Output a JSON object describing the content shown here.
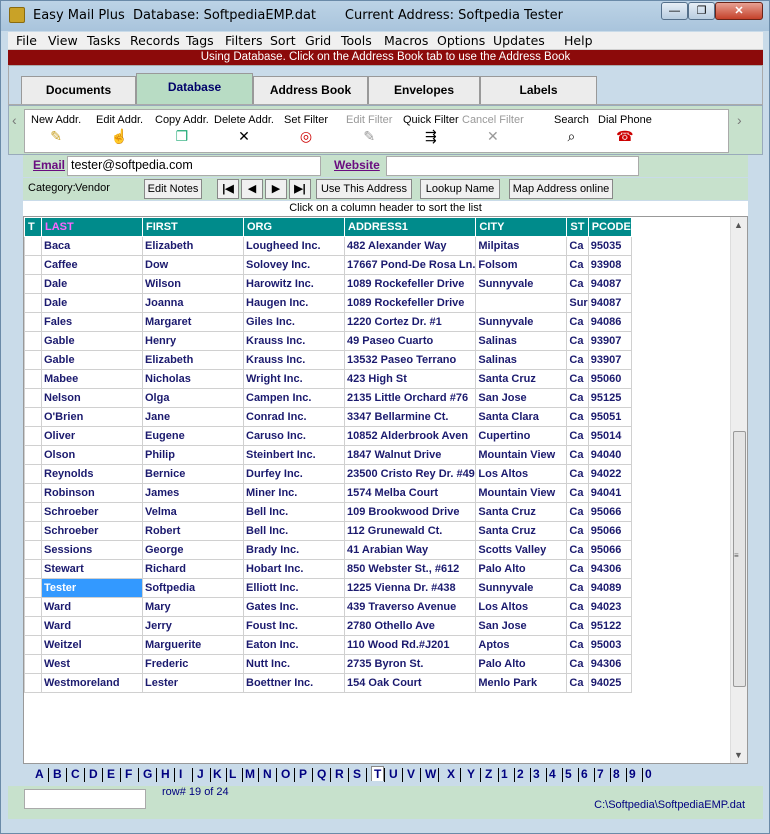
{
  "window": {
    "title": "Easy Mail Plus  Database: SoftpediaEMP.dat       Current Address: Softpedia Tester",
    "min": "—",
    "max": "❐",
    "close": "✕"
  },
  "menu": [
    "File",
    "View",
    "Tasks",
    "Records",
    "Tags",
    "Filters",
    "Sort",
    "Grid",
    "Tools",
    "Macros",
    "Options",
    "Updates",
    "Help"
  ],
  "banner": "Using Database. Click on the Address Book tab to use the Address Book",
  "tabs": [
    "Documents",
    "Database",
    "Address Book",
    "Envelopes",
    "Labels"
  ],
  "active_tab": "Database",
  "toolbar": {
    "new_addr": "New Addr.",
    "edit_addr": "Edit Addr.",
    "copy_addr": "Copy Addr.",
    "delete_addr": "Delete Addr.",
    "set_filter": "Set Filter",
    "edit_filter": "Edit Filter",
    "quick_filter": "Quick Filter",
    "cancel_filter": "Cancel Filter",
    "search": "Search",
    "dial_phone": "Dial Phone"
  },
  "contact": {
    "email_label": "Email",
    "email_value": "tester@softpedia.com",
    "website_label": "Website",
    "website_value": ""
  },
  "category": {
    "label": "Category:",
    "value": "Vendor",
    "edit_notes": "Edit Notes",
    "first": "|◀",
    "prev": "◀",
    "next": "▶",
    "last": "▶|",
    "use_address": "Use This Address",
    "lookup_name": "Lookup Name",
    "map_address": "Map Address online"
  },
  "hint": "Click on a column header to sort the list",
  "grid": {
    "columns": [
      "T",
      "LAST",
      "FIRST",
      "ORG",
      "ADDRESS1",
      "CITY",
      "ST",
      "PCODE"
    ],
    "sorted_column": "LAST",
    "rows": [
      [
        "",
        "Baca",
        "Elizabeth",
        "Lougheed Inc.",
        "482 Alexander Way",
        "Milpitas",
        "Ca",
        "95035"
      ],
      [
        "",
        "Caffee",
        "Dow",
        "Solovey Inc.",
        "17667 Pond-De Rosa Ln.",
        "Folsom",
        "Ca",
        "93908"
      ],
      [
        "",
        "Dale",
        "Wilson",
        "Harowitz Inc.",
        "1089 Rockefeller Drive",
        "Sunnyvale",
        "Ca",
        "94087"
      ],
      [
        "",
        "Dale",
        "Joanna",
        "Haugen Inc.",
        "1089 Rockefeller Drive",
        "",
        "Sur",
        "94087"
      ],
      [
        "",
        "Fales",
        "Margaret",
        "Giles Inc.",
        "1220 Cortez Dr. #1",
        "Sunnyvale",
        "Ca",
        "94086"
      ],
      [
        "",
        "Gable",
        "Henry",
        "Krauss Inc.",
        "49 Paseo Cuarto",
        "Salinas",
        "Ca",
        "93907"
      ],
      [
        "",
        "Gable",
        "Elizabeth",
        "Krauss Inc.",
        "13532 Paseo Terrano",
        "Salinas",
        "Ca",
        "93907"
      ],
      [
        "",
        "Mabee",
        "Nicholas",
        "Wright Inc.",
        "423 High St",
        "Santa Cruz",
        "Ca",
        "95060"
      ],
      [
        "",
        "Nelson",
        "Olga",
        "Campen Inc.",
        "2135 Little Orchard #76",
        "San Jose",
        "Ca",
        "95125"
      ],
      [
        "",
        "O'Brien",
        "Jane",
        "Conrad Inc.",
        "3347 Bellarmine Ct.",
        "Santa Clara",
        "Ca",
        "95051"
      ],
      [
        "",
        "Oliver",
        "Eugene",
        "Caruso Inc.",
        "10852 Alderbrook Aven",
        "Cupertino",
        "Ca",
        "95014"
      ],
      [
        "",
        "Olson",
        "Philip",
        "Steinbert Inc.",
        "1847 Walnut Drive",
        "Mountain View",
        "Ca",
        "94040"
      ],
      [
        "",
        "Reynolds",
        "Bernice",
        "Durfey Inc.",
        "23500 Cristo Rey Dr. #49",
        "Los Altos",
        "Ca",
        "94022"
      ],
      [
        "",
        "Robinson",
        "James",
        "Miner Inc.",
        "1574 Melba Court",
        "Mountain View",
        "Ca",
        "94041"
      ],
      [
        "",
        "Schroeber",
        "Velma",
        "Bell Inc.",
        "109 Brookwood Drive",
        "Santa Cruz",
        "Ca",
        "95066"
      ],
      [
        "",
        "Schroeber",
        "Robert",
        "Bell Inc.",
        "112 Grunewald Ct.",
        "Santa Cruz",
        "Ca",
        "95066"
      ],
      [
        "",
        "Sessions",
        "George",
        "Brady Inc.",
        "41 Arabian Way",
        "Scotts Valley",
        "Ca",
        "95066"
      ],
      [
        "",
        "Stewart",
        "Richard",
        "Hobart Inc.",
        "850 Webster St., #612",
        "Palo Alto",
        "Ca",
        "94306"
      ],
      [
        "",
        "Tester",
        "Softpedia",
        "Elliott Inc.",
        "1225 Vienna Dr. #438",
        "Sunnyvale",
        "Ca",
        "94089"
      ],
      [
        "",
        "Ward",
        "Mary",
        "Gates Inc.",
        "439 Traverso Avenue",
        "Los Altos",
        "Ca",
        "94023"
      ],
      [
        "",
        "Ward",
        "Jerry",
        "Foust Inc.",
        "2780 Othello Ave",
        "San Jose",
        "Ca",
        "95122"
      ],
      [
        "",
        "Weitzel",
        "Marguerite",
        "Eaton Inc.",
        "110 Wood Rd.#J201",
        "Aptos",
        "Ca",
        "95003"
      ],
      [
        "",
        "West",
        "Frederic",
        "Nutt Inc.",
        "2735 Byron St.",
        "Palo Alto",
        "Ca",
        "94306"
      ],
      [
        "",
        "Westmoreland",
        "Lester",
        "Boettner Inc.",
        "154 Oak Court",
        "Menlo Park",
        "Ca",
        "94025"
      ]
    ],
    "selected_row": 19
  },
  "alpha_tabs": [
    "A",
    "B",
    "C",
    "D",
    "E",
    "F",
    "G",
    "H",
    "I",
    "J",
    "K",
    "L",
    "M",
    "N",
    "O",
    "P",
    "Q",
    "R",
    "S",
    "T",
    "U",
    "V",
    "W",
    "X",
    "Y",
    "Z",
    "1",
    "2",
    "3",
    "4",
    "5",
    "6",
    "7",
    "8",
    "9",
    "0"
  ],
  "active_alpha": "T",
  "status": {
    "row": "row# 19 of 24",
    "path": "C:\\Softpedia\\SoftpediaEMP.dat"
  },
  "icons": {
    "new": "new-address-icon",
    "edit": "edit-address-icon",
    "copy": "copy-address-icon",
    "delete": "delete-icon",
    "filter": "filter-icon",
    "search": "search-icon",
    "phone": "phone-icon"
  }
}
